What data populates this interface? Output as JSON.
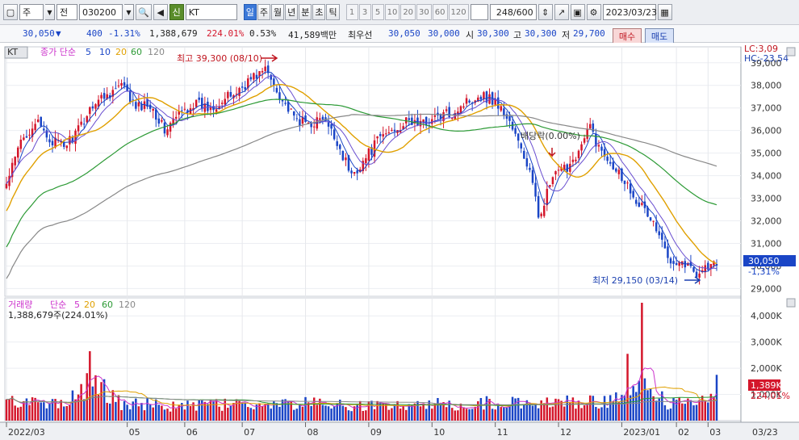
{
  "toolbar": {
    "market_label": "주",
    "type_label": "전",
    "stock_code": "030200",
    "signal_label": "신",
    "stock_name": "KT",
    "periods": [
      "일",
      "주",
      "월",
      "년",
      "분",
      "초",
      "틱"
    ],
    "active_period": "일",
    "nums": [
      "1",
      "3",
      "5",
      "10",
      "20",
      "30",
      "60",
      "120"
    ],
    "count": "248/600",
    "date": "2023/03/23"
  },
  "info": {
    "price": "30,050",
    "arrow": "▼",
    "change": "400",
    "change_pct": "-1.31%",
    "volume": "1,388,679",
    "vol_pct": "224.01%",
    "turnover": "0.53%",
    "amount": "41,589백만",
    "best_label": "최우선",
    "best_sell": "30,050",
    "best_buy": "30,000",
    "open_label": "시",
    "open": "30,300",
    "high_label": "고",
    "high": "30,300",
    "low_label": "저",
    "low": "29,700",
    "buy_btn": "매수",
    "sell_btn": "매도"
  },
  "price_legend": {
    "label": "종가 단순",
    "ma": [
      {
        "period": "5",
        "color": "#1a45c6"
      },
      {
        "period": "10",
        "color": "#1a45c6"
      },
      {
        "period": "20",
        "color": "#e0a000"
      },
      {
        "period": "60",
        "color": "#2c9a35"
      },
      {
        "period": "120",
        "color": "#888888"
      }
    ]
  },
  "volume_legend": {
    "label": "거래량",
    "ma_label": "단순",
    "ma": [
      {
        "period": "5",
        "color": "#cc33cc"
      },
      {
        "period": "20",
        "color": "#e0a000"
      },
      {
        "period": "60",
        "color": "#2c9a35"
      },
      {
        "period": "120",
        "color": "#888888"
      }
    ],
    "info": "1,388,679주(224.01%)"
  },
  "annotations": {
    "high": "최고 39,300 (08/10)",
    "low": "최저 29,150 (03/14)",
    "dividend": "배당락(0.00%)",
    "lc": "LC:3,09",
    "hc": "HC:-23,54",
    "price_tag": "30,050",
    "price_tag_pct": "-1,31%",
    "vol_tag": "1,389K",
    "vol_tag_pct": "224,01%"
  },
  "chart_data": {
    "type": "candlestick",
    "price_axis": {
      "ylim": [
        28800,
        39350
      ],
      "ticks": [
        "29,000",
        "30,000",
        "31,000",
        "32,000",
        "33,000",
        "34,000",
        "35,000",
        "36,000",
        "37,000",
        "38,000",
        "39,000"
      ]
    },
    "volume_axis": {
      "ylim": [
        0,
        4500
      ],
      "unit": "K",
      "ticks": [
        "1,000K",
        "2,000K",
        "3,000K",
        "4,000K"
      ]
    },
    "x_labels": [
      "2022/03",
      "05",
      "06",
      "07",
      "08",
      "09",
      "10",
      "11",
      "12",
      "2023/01",
      "02",
      "03",
      "03/23"
    ],
    "close_anchors": [
      [
        0,
        33600
      ],
      [
        5,
        35500
      ],
      [
        10,
        36400
      ],
      [
        15,
        35600
      ],
      [
        20,
        35300
      ],
      [
        25,
        36000
      ],
      [
        30,
        37200
      ],
      [
        35,
        37600
      ],
      [
        40,
        38000
      ],
      [
        45,
        37000
      ],
      [
        50,
        37200
      ],
      [
        55,
        36000
      ],
      [
        60,
        36700
      ],
      [
        65,
        37200
      ],
      [
        70,
        37000
      ],
      [
        75,
        37300
      ],
      [
        80,
        37700
      ],
      [
        85,
        38300
      ],
      [
        90,
        38700
      ],
      [
        95,
        37600
      ],
      [
        100,
        36500
      ],
      [
        105,
        36300
      ],
      [
        110,
        36500
      ],
      [
        115,
        35500
      ],
      [
        120,
        34000
      ],
      [
        125,
        34800
      ],
      [
        130,
        35700
      ],
      [
        135,
        36100
      ],
      [
        140,
        36400
      ],
      [
        145,
        36300
      ],
      [
        150,
        36600
      ],
      [
        155,
        36800
      ],
      [
        160,
        37300
      ],
      [
        165,
        37600
      ],
      [
        170,
        37300
      ],
      [
        175,
        36400
      ],
      [
        180,
        34800
      ],
      [
        182,
        34200
      ],
      [
        185,
        32200
      ],
      [
        190,
        33900
      ],
      [
        195,
        34400
      ],
      [
        200,
        35300
      ],
      [
        203,
        36200
      ],
      [
        206,
        35200
      ],
      [
        210,
        34700
      ],
      [
        215,
        33800
      ],
      [
        220,
        32800
      ],
      [
        225,
        31900
      ],
      [
        230,
        30400
      ],
      [
        235,
        30200
      ],
      [
        240,
        29700
      ],
      [
        244,
        30000
      ],
      [
        247,
        30050
      ]
    ],
    "volume_anchors": [
      [
        0,
        700
      ],
      [
        20,
        580
      ],
      [
        29,
        1550
      ],
      [
        40,
        660
      ],
      [
        60,
        560
      ],
      [
        80,
        620
      ],
      [
        100,
        660
      ],
      [
        120,
        600
      ],
      [
        140,
        600
      ],
      [
        160,
        640
      ],
      [
        175,
        700
      ],
      [
        190,
        760
      ],
      [
        200,
        680
      ],
      [
        210,
        780
      ],
      [
        221,
        1300
      ],
      [
        227,
        1000
      ],
      [
        230,
        600
      ],
      [
        240,
        720
      ],
      [
        247,
        1389
      ]
    ]
  }
}
